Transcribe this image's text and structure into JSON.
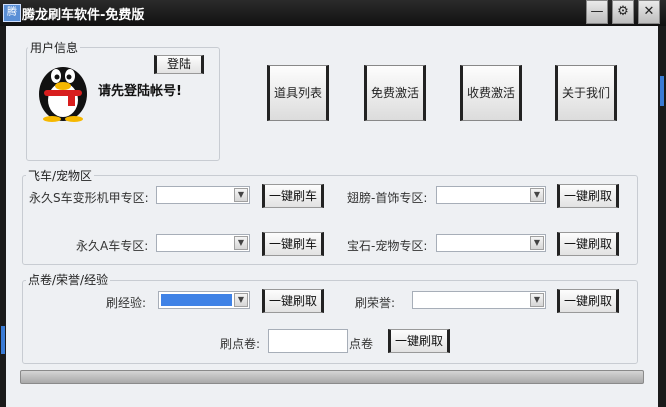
{
  "window": {
    "title": "腾龙刷车软件-免费版",
    "app_icon_text": "腾"
  },
  "titlebar": {
    "minimize": "—",
    "settings": "⚙",
    "close": "✕"
  },
  "user_info": {
    "legend": "用户信息",
    "login_button": "登陆",
    "prompt": "请先登陆帐号!"
  },
  "top_buttons": [
    "道具列表",
    "免费激活",
    "收费激活",
    "关于我们"
  ],
  "vehicle": {
    "legend": "飞车/宠物区",
    "row1_left_label": "永久S车变形机甲专区:",
    "row1_left_button": "一键刷车",
    "row1_right_label": "翅膀-首饰专区:",
    "row1_right_button": "一键刷取",
    "row2_left_label": "永久A车专区:",
    "row2_left_button": "一键刷车",
    "row2_right_label": "宝石-宠物专区:",
    "row2_right_button": "一键刷取"
  },
  "points": {
    "legend": "点卷/荣誉/经验",
    "exp_label": "刷经验:",
    "exp_button": "一键刷取",
    "honor_label": "刷荣誉:",
    "honor_button": "一键刷取",
    "coupon_label": "刷点卷:",
    "coupon_unit": "点卷",
    "coupon_button": "一键刷取"
  },
  "colors": {
    "accent": "#3f82e6",
    "titlebar": "#111111"
  },
  "progress": {
    "value": 0
  }
}
